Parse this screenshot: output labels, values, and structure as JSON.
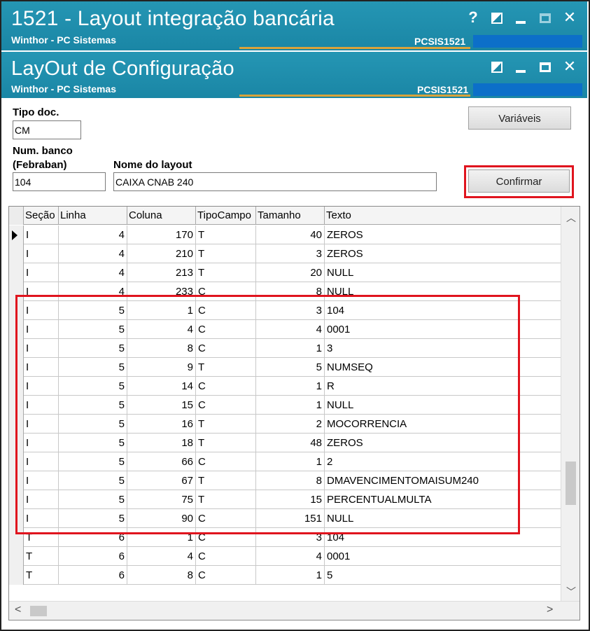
{
  "main_window": {
    "title": "1521 - Layout integração bancária",
    "subtitle": "Winthor - PC Sistemas",
    "code": "PCSIS1521",
    "help_label": "?"
  },
  "dialog": {
    "title": "LayOut de Configuração",
    "subtitle": "Winthor - PC Sistemas",
    "code": "PCSIS1521"
  },
  "form": {
    "tipo_doc_label": "Tipo doc.",
    "tipo_doc_value": "CM",
    "num_banco_label_1": "Num. banco",
    "num_banco_label_2": "(Febraban)",
    "num_banco_value": "104",
    "nome_layout_label": "Nome do layout",
    "nome_layout_value": "CAIXA CNAB 240",
    "variaveis_button": "Variáveis",
    "confirmar_button": "Confirmar"
  },
  "grid": {
    "columns": [
      "Seção",
      "Linha",
      "Coluna",
      "TipoCampo",
      "Tamanho",
      "Texto"
    ],
    "rows": [
      [
        "I",
        "4",
        "170",
        "T",
        "40",
        "ZEROS"
      ],
      [
        "I",
        "4",
        "210",
        "T",
        "3",
        "ZEROS"
      ],
      [
        "I",
        "4",
        "213",
        "T",
        "20",
        "NULL"
      ],
      [
        "I",
        "4",
        "233",
        "C",
        "8",
        "NULL"
      ],
      [
        "I",
        "5",
        "1",
        "C",
        "3",
        "104"
      ],
      [
        "I",
        "5",
        "4",
        "C",
        "4",
        "0001"
      ],
      [
        "I",
        "5",
        "8",
        "C",
        "1",
        "3"
      ],
      [
        "I",
        "5",
        "9",
        "T",
        "5",
        "NUMSEQ"
      ],
      [
        "I",
        "5",
        "14",
        "C",
        "1",
        "R"
      ],
      [
        "I",
        "5",
        "15",
        "C",
        "1",
        "NULL"
      ],
      [
        "I",
        "5",
        "16",
        "T",
        "2",
        "MOCORRENCIA"
      ],
      [
        "I",
        "5",
        "18",
        "T",
        "48",
        "ZEROS"
      ],
      [
        "I",
        "5",
        "66",
        "C",
        "1",
        "2"
      ],
      [
        "I",
        "5",
        "67",
        "T",
        "8",
        "DMAVENCIMENTOMAISUM240"
      ],
      [
        "I",
        "5",
        "75",
        "T",
        "15",
        "PERCENTUALMULTA"
      ],
      [
        "I",
        "5",
        "90",
        "C",
        "151",
        "NULL"
      ],
      [
        "T",
        "6",
        "1",
        "C",
        "3",
        "104"
      ],
      [
        "T",
        "6",
        "4",
        "C",
        "4",
        "0001"
      ],
      [
        "T",
        "6",
        "8",
        "C",
        "1",
        "5"
      ]
    ],
    "selected_row": 0
  },
  "colors": {
    "titlebar": "#1a86a5",
    "highlight": "#e0141e",
    "accent_line": "#d9a33a"
  }
}
